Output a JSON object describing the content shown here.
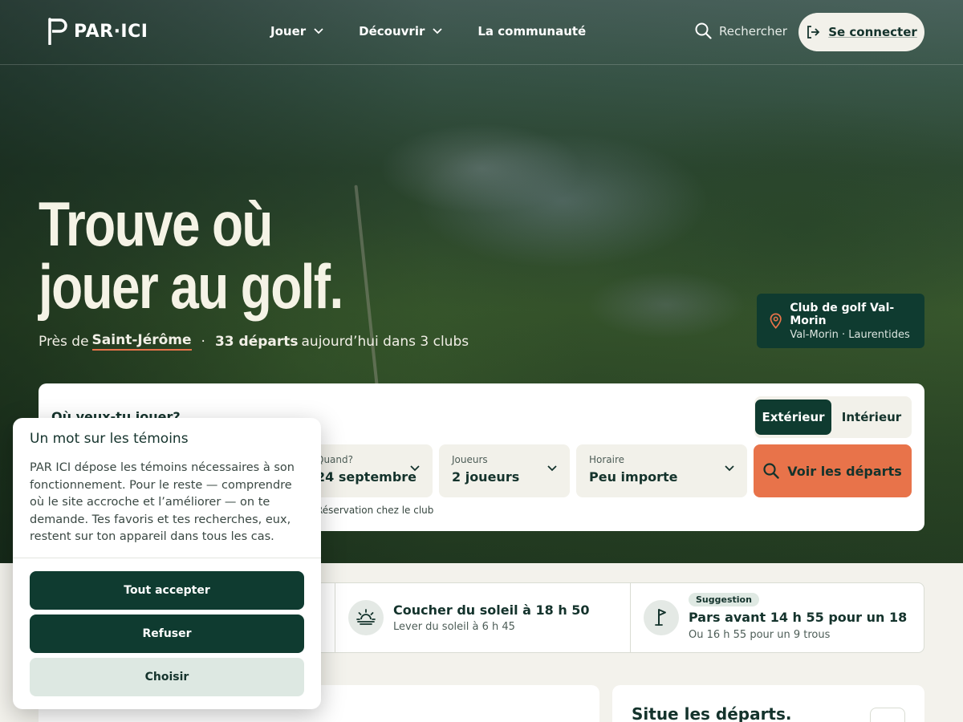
{
  "nav": {
    "logo_text": "PAR·ICI",
    "links": [
      {
        "label": "Jouer",
        "has_menu": true
      },
      {
        "label": "Découvrir",
        "has_menu": true
      },
      {
        "label": "La communauté",
        "has_menu": false
      }
    ],
    "search_label": "Rechercher",
    "login_label": "Se connecter"
  },
  "hero": {
    "headline_line1": "Trouve où",
    "headline_line2": "jouer au golf.",
    "near_prefix": "Près de",
    "city": "Saint-Jérôme",
    "separator": "·",
    "departures_count": "33 départs",
    "departures_rest": "aujourd’hui dans 3 clubs",
    "club_name": "Club de golf Val-Morin",
    "club_location": "Val-Morin · Laurentides"
  },
  "search": {
    "question": "Où veux-tu jouer?",
    "toggle": [
      "Extérieur",
      "Intérieur"
    ],
    "toggle_selected": "Extérieur",
    "fields": [
      {
        "label": "Quand?",
        "value": "24 septembre"
      },
      {
        "label": "Joueurs",
        "value": "2 joueurs"
      },
      {
        "label": "Horaire",
        "value": "Peu importe"
      }
    ],
    "cta_label": "Voir les départs",
    "note": "Réservation chez le club"
  },
  "info": {
    "sun_title": "Coucher du soleil à 18 h 50",
    "sun_sub": "Lever du soleil à 6 h 45",
    "suggestion_tag": "Suggestion",
    "suggestion_title": "Pars avant 14 h 55 pour un 18",
    "suggestion_sub": "Ou 16 h 55 pour un 9 trous"
  },
  "cards": {
    "right_title": "Situe les départs."
  },
  "cookie": {
    "title": "Un mot sur les témoins",
    "text": "PAR ICI dépose les témoins nécessaires à son fonctionnement. Pour le reste — comprendre où le site accroche et l’améliorer — on te demande. Tes favoris et tes recherches, eux, restent sur ton appareil dans tous les cas.",
    "accept_label": "Tout accepter",
    "refuse_label": "Refuser",
    "choose_label": "Choisir"
  },
  "colors": {
    "brand_dark": "#0f3b30",
    "accent": "#e8734a",
    "cream": "#f2f1ea"
  }
}
